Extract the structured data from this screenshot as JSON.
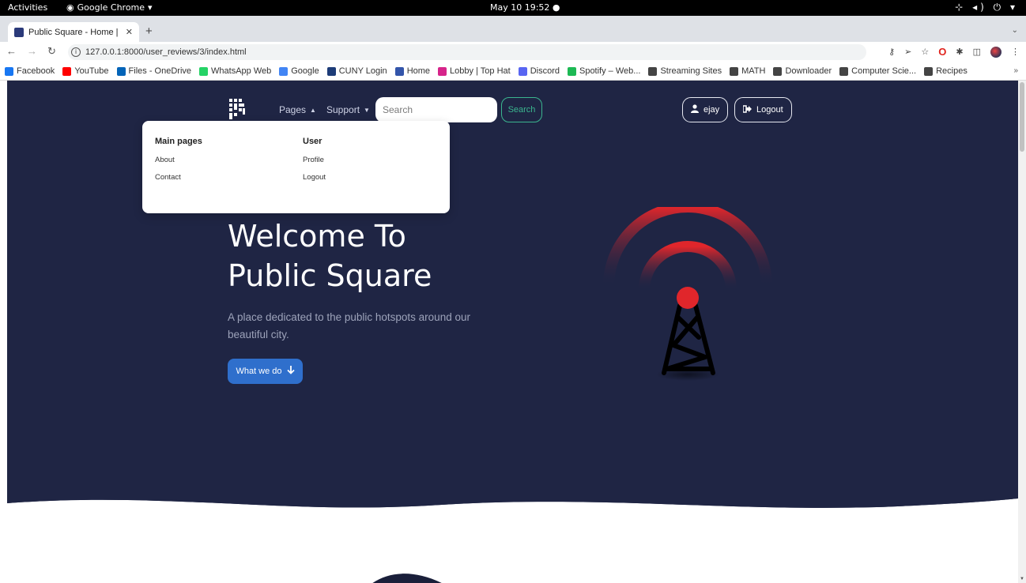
{
  "os_bar": {
    "activities": "Activities",
    "app_name": "Google Chrome",
    "clock": "May 10  19:52"
  },
  "browser": {
    "tab_title": "Public Square - Home | Pu",
    "url": "127.0.0.1:8000/user_reviews/3/index.html",
    "bookmarks": [
      {
        "label": "Facebook",
        "color": "#1877f2"
      },
      {
        "label": "YouTube",
        "color": "#ff0000"
      },
      {
        "label": "Files - OneDrive",
        "color": "#0364b8"
      },
      {
        "label": "WhatsApp Web",
        "color": "#25d366"
      },
      {
        "label": "Google",
        "color": "#4285f4"
      },
      {
        "label": "CUNY Login",
        "color": "#1d3c78"
      },
      {
        "label": "Home",
        "color": "#3355aa"
      },
      {
        "label": "Lobby | Top Hat",
        "color": "#d6248a"
      },
      {
        "label": "Discord",
        "color": "#5865f2"
      },
      {
        "label": "Spotify – Web...",
        "color": "#1db954"
      },
      {
        "label": "Streaming Sites",
        "color": "#444444"
      },
      {
        "label": "MATH",
        "color": "#444444"
      },
      {
        "label": "Downloader",
        "color": "#444444"
      },
      {
        "label": "Computer Scie...",
        "color": "#444444"
      },
      {
        "label": "Recipes",
        "color": "#444444"
      }
    ]
  },
  "navbar": {
    "pages_label": "Pages",
    "support_label": "Support",
    "search_placeholder": "Search",
    "search_button": "Search",
    "user_label": "ejay",
    "logout_label": "Logout"
  },
  "dropdown": {
    "main_heading": "Main pages",
    "main_items": [
      "About",
      "Contact"
    ],
    "user_heading": "User",
    "user_items": [
      "Profile",
      "Logout"
    ]
  },
  "hero": {
    "title_line1": "Welcome To",
    "title_line2": "Public Square",
    "subtitle": "A place dedicated to the public hotspots around our beautiful city.",
    "cta_label": "What we do"
  },
  "colors": {
    "hero_bg": "#1f2544",
    "accent_green": "#3bb58f",
    "cta_blue": "#2f6fcc",
    "signal_red": "#e0262b"
  }
}
